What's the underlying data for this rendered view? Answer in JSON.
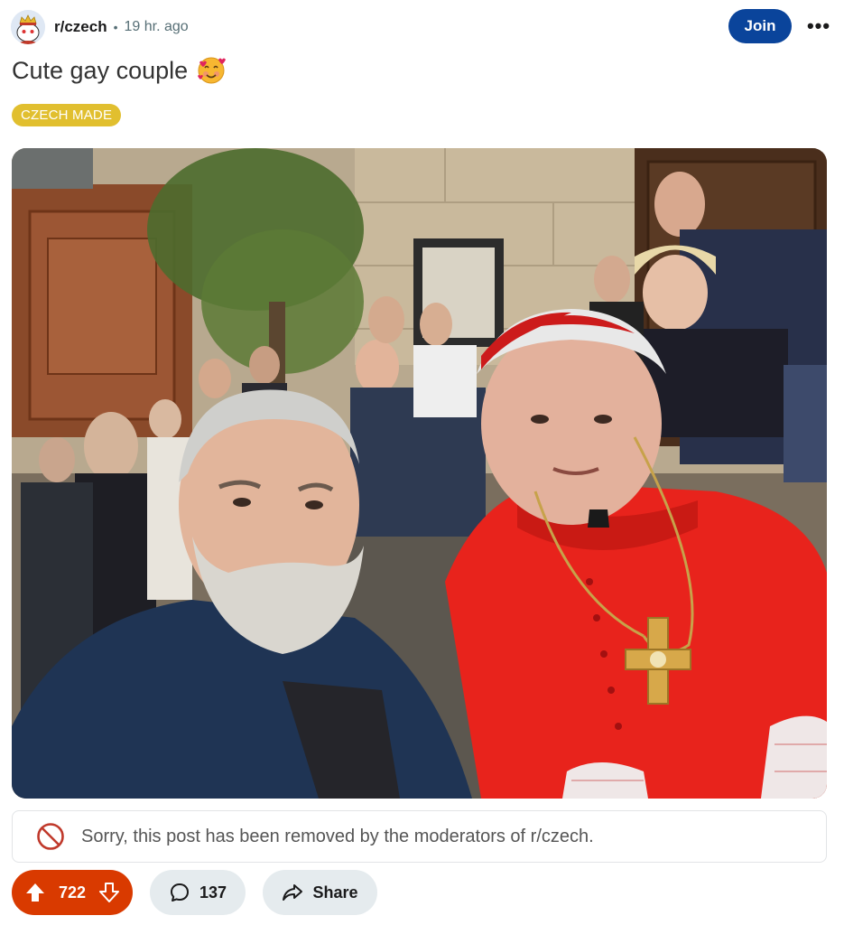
{
  "post": {
    "subreddit": "r/czech",
    "separator": "•",
    "time": "19 hr. ago",
    "join_label": "Join",
    "more_label": "•••",
    "title": "Cute gay couple",
    "title_emoji": "smiling-face-with-hearts",
    "flair": "CZECH MADE",
    "removed_notice": "Sorry, this post has been removed by the moderators of r/czech.",
    "score": "722",
    "comments": "137",
    "share_label": "Share"
  },
  "colors": {
    "join": "#0a449b",
    "flair": "#e1bf2f",
    "vote": "#d93a00",
    "pill": "#e5ebee",
    "removed_icon": "#c0392b"
  },
  "icons": {
    "avatar": "reddit-snoo-king-icon",
    "more": "ellipsis-icon",
    "removed": "ban-icon",
    "upvote": "arrow-up-icon",
    "downvote": "arrow-down-icon",
    "comment": "speech-bubble-icon",
    "share": "share-arrow-icon"
  }
}
